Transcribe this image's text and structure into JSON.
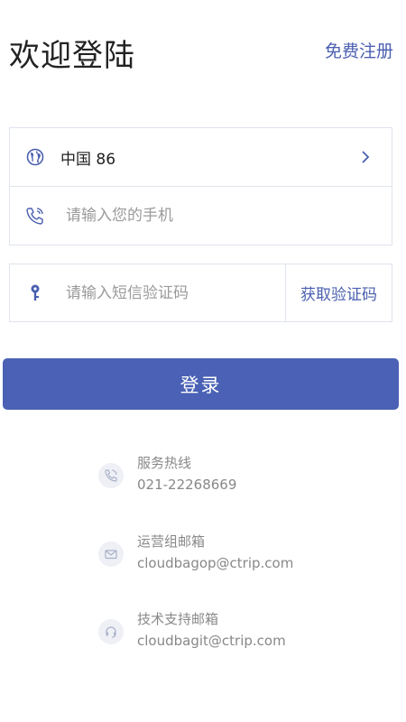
{
  "header": {
    "title": "欢迎登陆",
    "register_label": "免费注册"
  },
  "form": {
    "country": "中国 86",
    "phone_placeholder": "请输入您的手机",
    "sms_placeholder": "请输入短信验证码",
    "get_code_label": "获取验证码",
    "login_label": "登录"
  },
  "contacts": [
    {
      "label": "服务热线",
      "value": "021-22268669",
      "icon": "phone-icon"
    },
    {
      "label": "运营组邮箱",
      "value": "cloudbagop@ctrip.com",
      "icon": "mail-icon"
    },
    {
      "label": "技术支持邮箱",
      "value": "cloudbagit@ctrip.com",
      "icon": "headset-icon"
    }
  ],
  "colors": {
    "accent": "#4a61b5",
    "link": "#4a5fb0",
    "border": "#dfe3ee",
    "muted_text": "#888888"
  }
}
